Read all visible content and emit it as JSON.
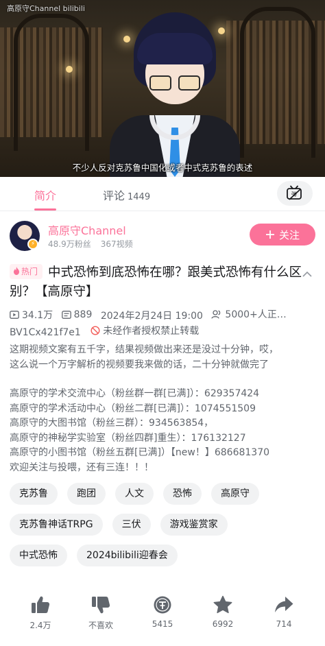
{
  "video": {
    "channel_watermark": "高原守Channel bilibili",
    "subtitle": "不少人反对克苏鲁中国化或者中式克苏鲁的表述"
  },
  "tabs": [
    {
      "label": "简介",
      "count": "",
      "active": true
    },
    {
      "label": "评论",
      "count": "1449",
      "active": false
    }
  ],
  "danmaku_button_icon": "danmaku-toggle-icon",
  "uploader": {
    "name": "高原守Channel",
    "fans": "48.9万粉丝",
    "videos": "367视频",
    "badge": "⚡",
    "follow_label": "关注"
  },
  "title": {
    "hot_badge": "热门",
    "text": "中式恐怖到底恐怖在哪？跟美式恐怖有什么区别？【高原守】"
  },
  "meta": {
    "views": "34.1万",
    "danmaku": "889",
    "date": "2024年2月24日 19:00",
    "watching": "5000+人正…",
    "bvid": "BV1Cx421f7e1",
    "copyright": "未经作者授权禁止转载"
  },
  "description": {
    "paragraph1": [
      "这期视频文案有五千字，结果视频做出来还是没过十分钟，哎，",
      "这么说一个万字解析的视频要我来做的话，二十分钟就做完了"
    ],
    "paragraph2": [
      "高原守的学术交流中心（粉丝群一群[已满]）：629357424",
      "高原守的学术活动中心（粉丝二群[已满]）：1074551509",
      "高原守的大图书馆（粉丝三群）：934563854，",
      "高原守的神秘学实验室（粉丝四群]重生）：176132127",
      "高原守的小图书馆（粉丝五群[已满]）【new！】686681370",
      "欢迎关注与投喂，还有三连！！！"
    ]
  },
  "tags": [
    [
      "克苏鲁",
      "跑团",
      "人文",
      "恐怖",
      "高原守"
    ],
    [
      "克苏鲁神话TRPG",
      "三伏",
      "游戏鉴赏家"
    ],
    [
      "中式恐怖",
      "2024bilibili迎春会"
    ]
  ],
  "actions": [
    {
      "icon": "thumbs-up-icon",
      "label": "2.4万"
    },
    {
      "icon": "thumbs-down-icon",
      "label": "不喜欢"
    },
    {
      "icon": "coin-icon",
      "label": "5415"
    },
    {
      "icon": "star-icon",
      "label": "6992"
    },
    {
      "icon": "share-icon",
      "label": "714"
    }
  ],
  "colors": {
    "accent": "#fb7299",
    "text_primary": "#18191c",
    "text_secondary": "#61666d",
    "tag_bg": "#f1f2f3"
  }
}
